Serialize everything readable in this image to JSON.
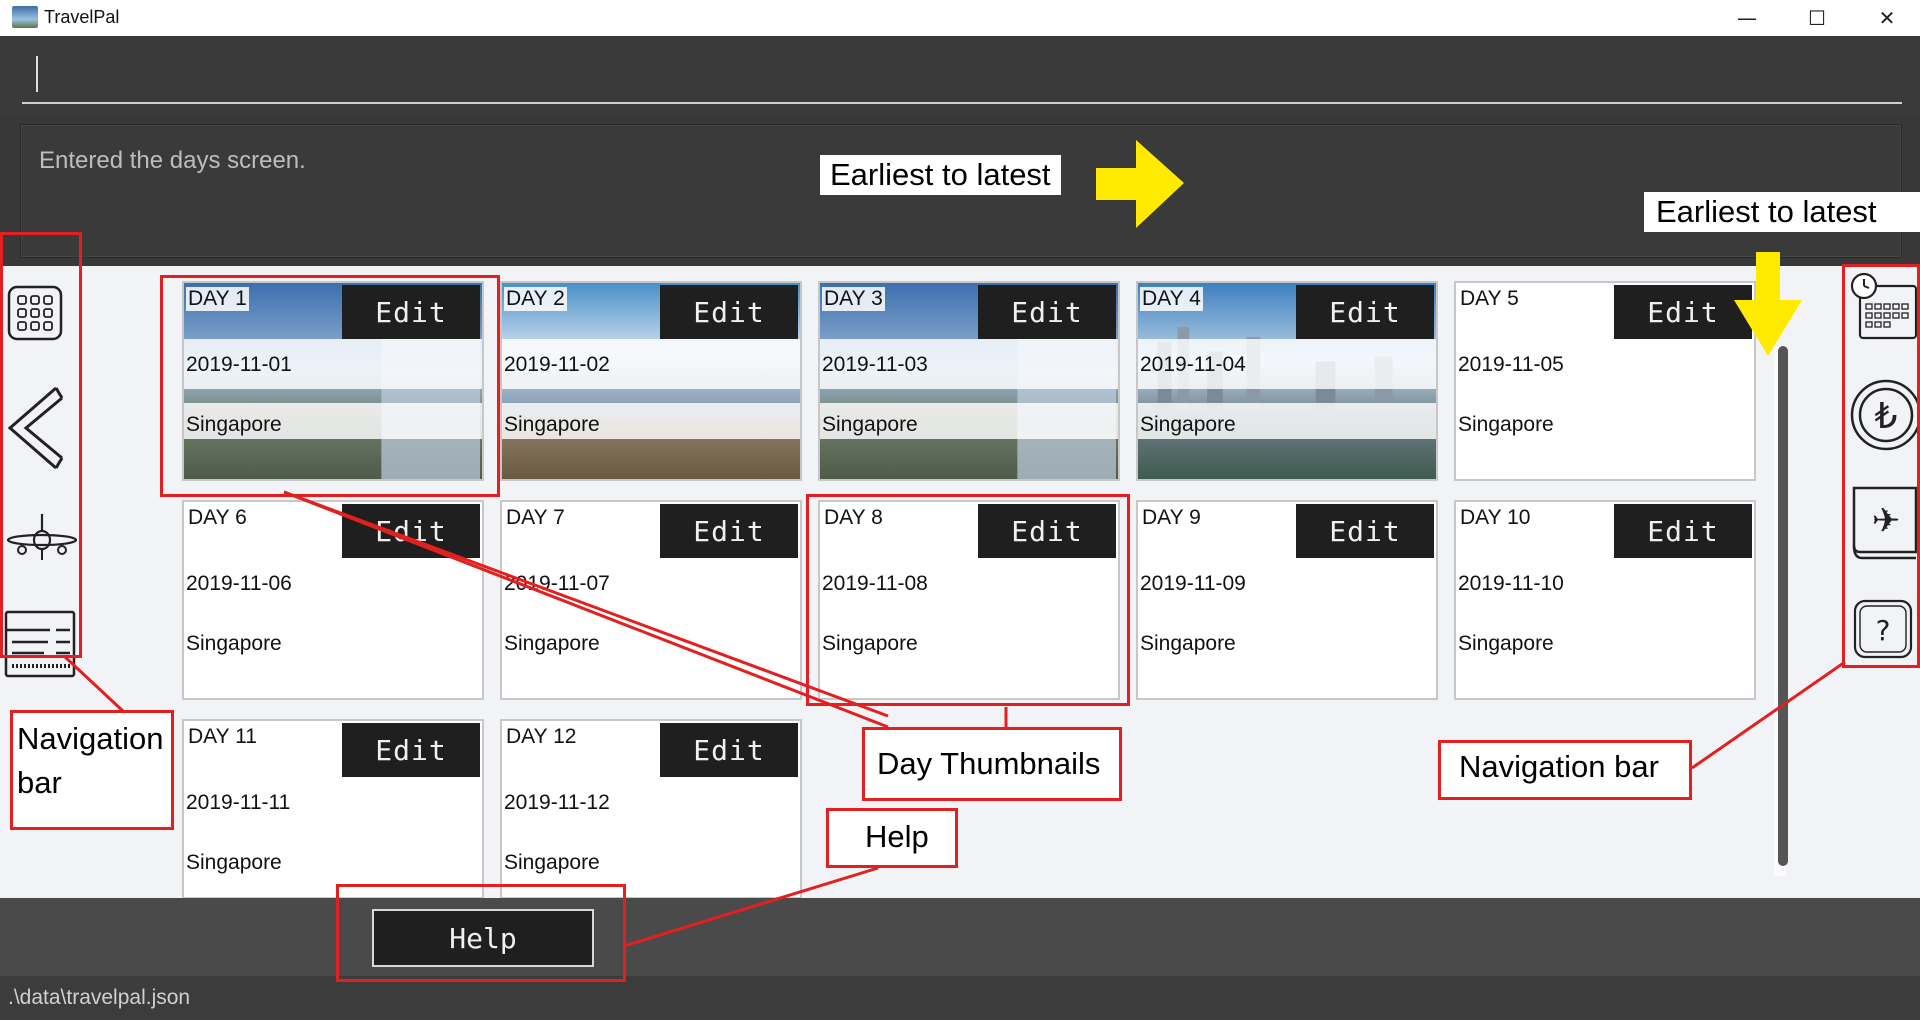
{
  "window": {
    "title": "TravelPal",
    "minimize": "—",
    "maximize": "☐",
    "close": "✕"
  },
  "command": {
    "value": "",
    "placeholder": ""
  },
  "result": {
    "text": "Entered the days screen."
  },
  "left_nav": {
    "items": [
      {
        "name": "grid-icon"
      },
      {
        "name": "back-arrow-icon"
      },
      {
        "name": "airplane-icon"
      },
      {
        "name": "ticket-icon"
      }
    ]
  },
  "right_nav": {
    "items": [
      {
        "name": "calendar-clock-icon"
      },
      {
        "name": "currency-icon"
      },
      {
        "name": "booking-book-icon"
      },
      {
        "name": "help-icon"
      }
    ]
  },
  "days": [
    {
      "day": "DAY 1",
      "date": "2019-11-01",
      "location": "Singapore",
      "edit": "Edit",
      "image": "waterfall"
    },
    {
      "day": "DAY 2",
      "date": "2019-11-02",
      "location": "Singapore",
      "edit": "Edit",
      "image": "sky-desert"
    },
    {
      "day": "DAY 3",
      "date": "2019-11-03",
      "location": "Singapore",
      "edit": "Edit",
      "image": "waterfall"
    },
    {
      "day": "DAY 4",
      "date": "2019-11-04",
      "location": "Singapore",
      "edit": "Edit",
      "image": "city"
    },
    {
      "day": "DAY 5",
      "date": "2019-11-05",
      "location": "Singapore",
      "edit": "Edit",
      "image": ""
    },
    {
      "day": "DAY 6",
      "date": "2019-11-06",
      "location": "Singapore",
      "edit": "Edit",
      "image": ""
    },
    {
      "day": "DAY 7",
      "date": "2019-11-07",
      "location": "Singapore",
      "edit": "Edit",
      "image": ""
    },
    {
      "day": "DAY 8",
      "date": "2019-11-08",
      "location": "Singapore",
      "edit": "Edit",
      "image": ""
    },
    {
      "day": "DAY 9",
      "date": "2019-11-09",
      "location": "Singapore",
      "edit": "Edit",
      "image": ""
    },
    {
      "day": "DAY 10",
      "date": "2019-11-10",
      "location": "Singapore",
      "edit": "Edit",
      "image": ""
    },
    {
      "day": "DAY 11",
      "date": "2019-11-11",
      "location": "Singapore",
      "edit": "Edit",
      "image": ""
    },
    {
      "day": "DAY 12",
      "date": "2019-11-12",
      "location": "Singapore",
      "edit": "Edit",
      "image": ""
    }
  ],
  "help_button": {
    "label": "Help"
  },
  "status": {
    "path": ".\\data\\travelpal.json"
  },
  "annotations": {
    "earliest_top": "Earliest to latest",
    "earliest_right": "Earliest to latest",
    "nav_left": "Navigation bar",
    "nav_right": "Navigation bar",
    "day_thumbnails": "Day Thumbnails",
    "help": "Help"
  },
  "colors": {
    "annotation_red": "#e1201f",
    "arrow_yellow": "#ffea00"
  }
}
